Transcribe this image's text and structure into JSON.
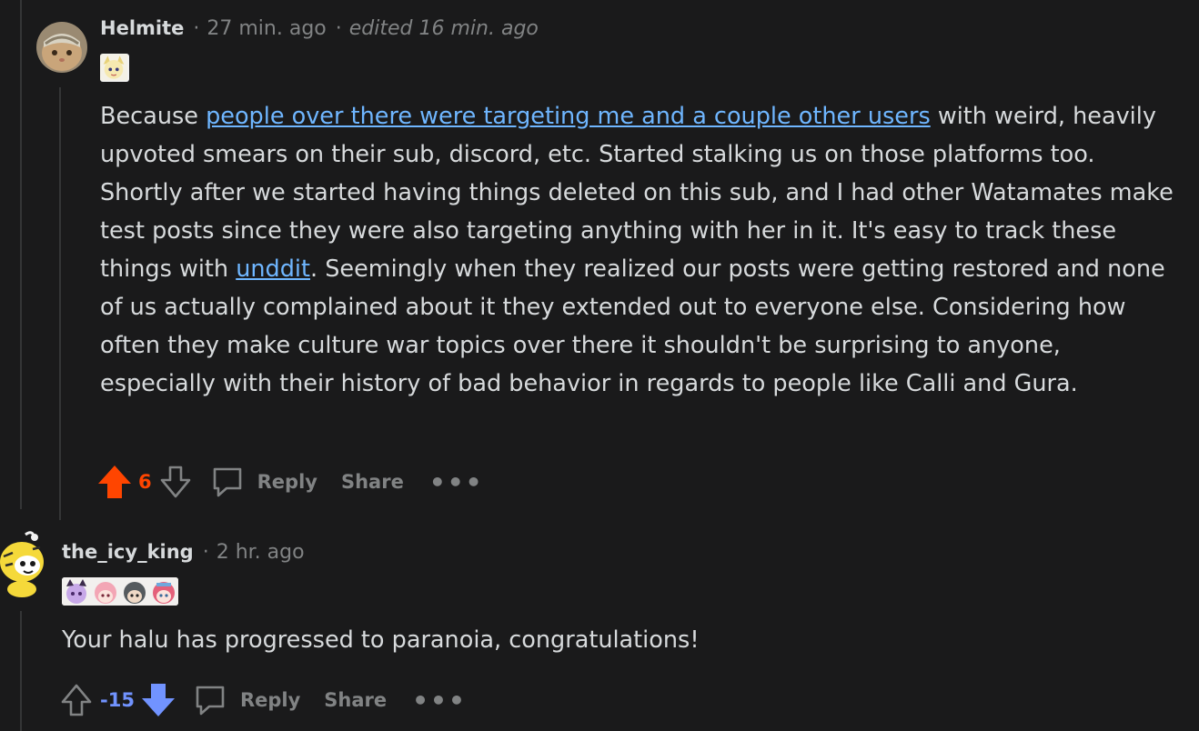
{
  "comment1": {
    "username": "Helmite",
    "separator": "·",
    "time": "27 min. ago",
    "edited": "edited 16 min. ago",
    "body_before_link1": "Because ",
    "link1_text": "people over there were targeting me and a couple other users",
    "body_middle": " with weird, heavily upvoted smears on their sub, discord, etc. Started stalking us on those platforms too. Shortly after we started having things deleted on this sub, and I had other Watamates make test posts since they were also targeting anything with her in it. It's easy to track these things with ",
    "link2_text": "unddit",
    "body_after_link2": ". Seemingly when they realized our posts were getting restored and none of us actually complained about it they extended out to everyone else. Considering how often they make culture war topics over there it shouldn't be surprising to anyone, especially with their history of bad behavior in regards to people like Calli and Gura.",
    "score": "6",
    "reply_label": "Reply",
    "share_label": "Share",
    "more_label": "•••",
    "vote_state": "upvoted",
    "upvote_icon": "arrow-up-icon",
    "downvote_icon": "arrow-down-icon",
    "reply_icon": "comment-bubble-icon"
  },
  "comment2": {
    "username": "the_icy_king",
    "separator": "·",
    "time": "2 hr. ago",
    "body": "Your halu has progressed to paranoia, congratulations!",
    "score": "-15",
    "reply_label": "Reply",
    "share_label": "Share",
    "more_label": "•••",
    "vote_state": "downvoted"
  },
  "colors": {
    "background": "#1a1a1b",
    "text": "#d7dadc",
    "muted": "#818384",
    "link": "#6fb6ff",
    "upvote": "#ff4500",
    "downvote": "#7193ff"
  }
}
